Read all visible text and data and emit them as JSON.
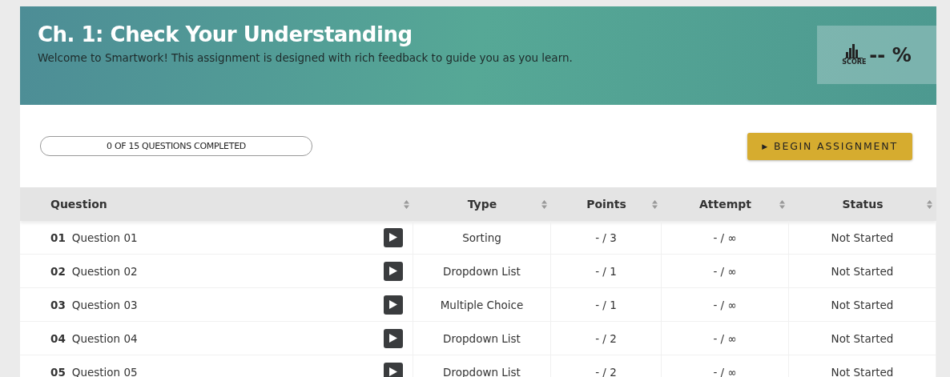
{
  "header": {
    "title": "Ch. 1: Check Your Understanding",
    "subtitle": "Welcome to Smartwork! This assignment is designed with rich feedback to guide you as you learn.",
    "score": {
      "label": "SCORE",
      "value": "-- %"
    }
  },
  "progress": {
    "text": "0 OF 15 QUESTIONS COMPLETED",
    "level": 0
  },
  "begin_button": {
    "icon": "▶",
    "label": "BEGIN ASSIGNMENT"
  },
  "table": {
    "columns": [
      "Question",
      "Type",
      "Points",
      "Attempt",
      "Status"
    ],
    "rows": [
      {
        "number": "01",
        "title": "Question 01",
        "type": "Sorting",
        "points": "- / 3",
        "attempt": "- / ∞",
        "status": "Not Started"
      },
      {
        "number": "02",
        "title": "Question 02",
        "type": "Dropdown List",
        "points": "- / 1",
        "attempt": "- / ∞",
        "status": "Not Started"
      },
      {
        "number": "03",
        "title": "Question 03",
        "type": "Multiple Choice",
        "points": "- / 1",
        "attempt": "- / ∞",
        "status": "Not Started"
      },
      {
        "number": "04",
        "title": "Question 04",
        "type": "Dropdown List",
        "points": "- / 2",
        "attempt": "- / ∞",
        "status": "Not Started"
      },
      {
        "number": "05",
        "title": "Question 05",
        "type": "Dropdown List",
        "points": "- / 2",
        "attempt": "- / ∞",
        "status": "Not Started"
      }
    ]
  }
}
